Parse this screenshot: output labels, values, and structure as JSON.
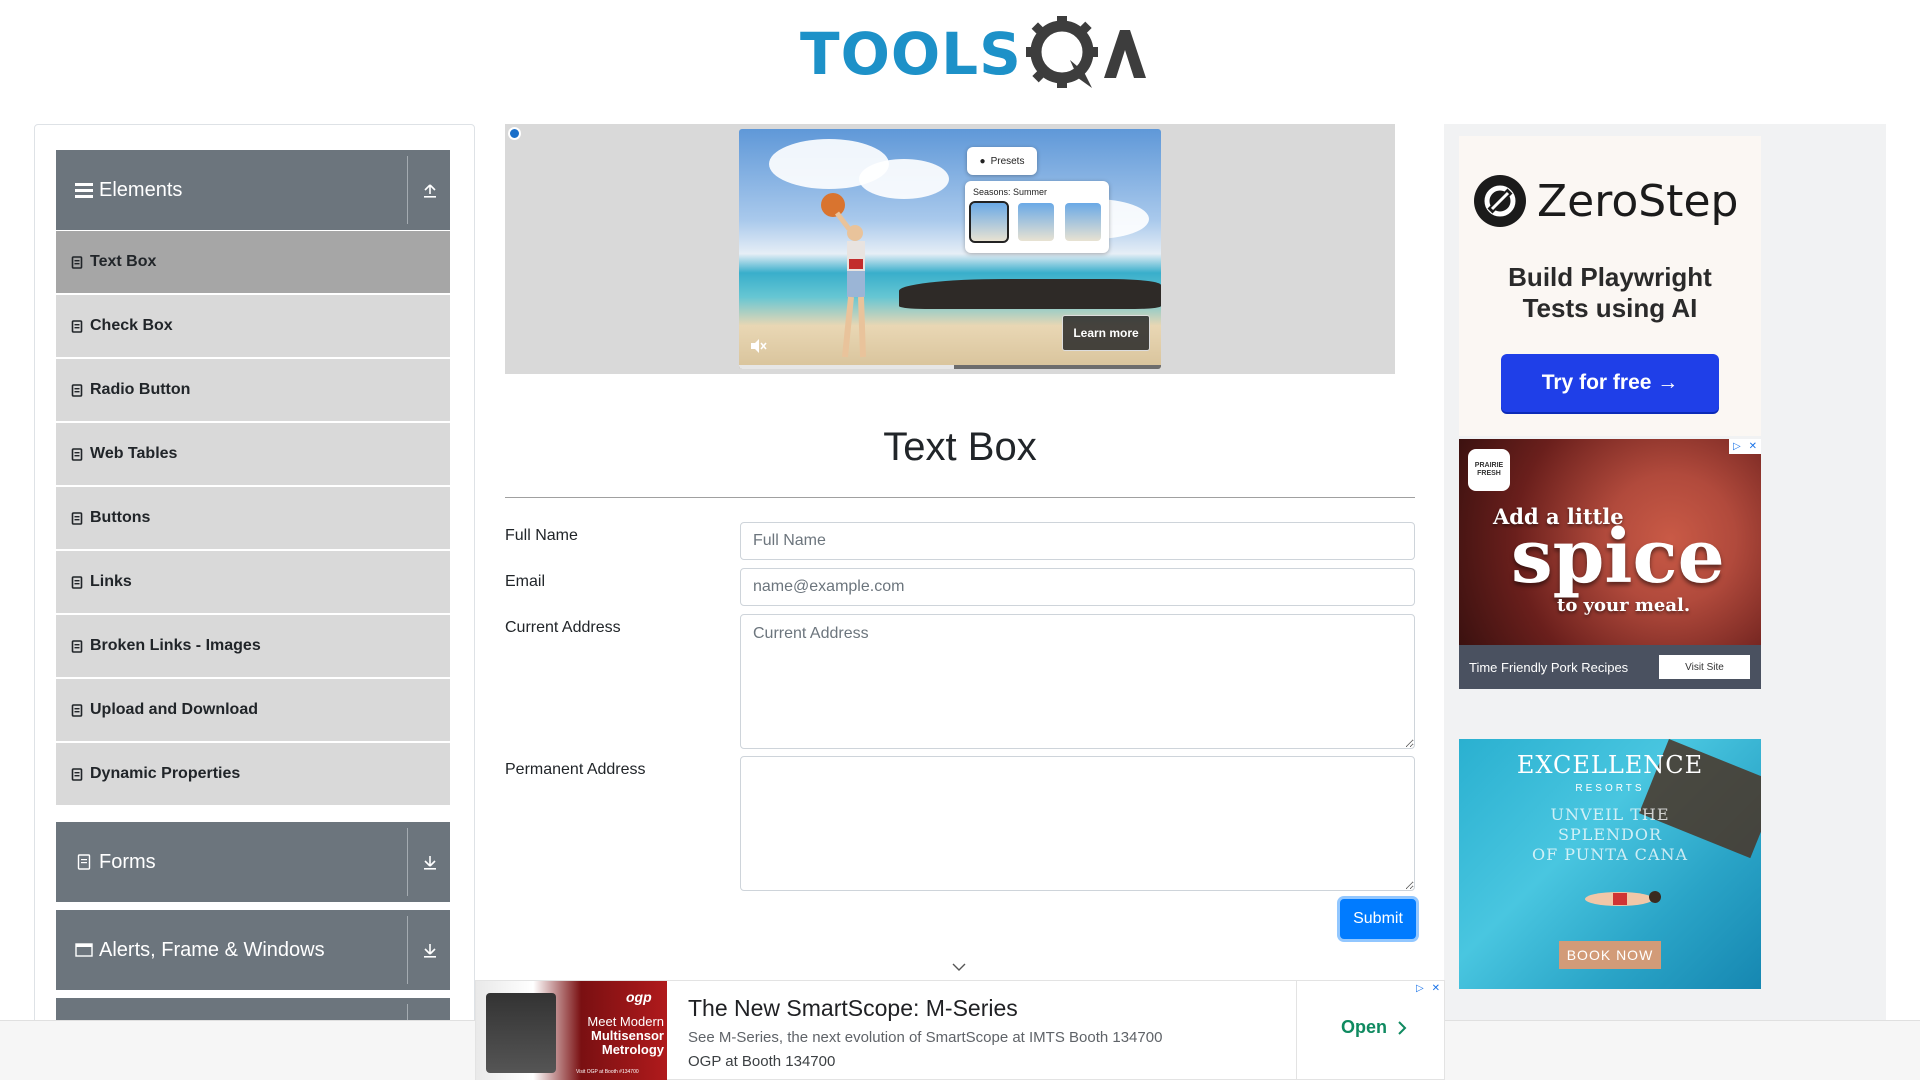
{
  "header": {
    "logo_text": "TOOLSQA"
  },
  "sidebar": {
    "groups": [
      {
        "title": "Elements",
        "icon": "hamburger-icon",
        "expanded": true,
        "arrow": "collapse-arrow-icon"
      },
      {
        "title": "Forms",
        "icon": "file-icon",
        "expanded": false,
        "arrow": "expand-arrow-icon"
      },
      {
        "title": "Alerts, Frame & Windows",
        "icon": "window-icon",
        "expanded": false,
        "arrow": "expand-arrow-icon"
      }
    ],
    "items": [
      {
        "label": "Text Box",
        "active": true
      },
      {
        "label": "Check Box",
        "active": false
      },
      {
        "label": "Radio Button",
        "active": false
      },
      {
        "label": "Web Tables",
        "active": false
      },
      {
        "label": "Buttons",
        "active": false
      },
      {
        "label": "Links",
        "active": false
      },
      {
        "label": "Broken Links - Images",
        "active": false
      },
      {
        "label": "Upload and Download",
        "active": false
      },
      {
        "label": "Dynamic Properties",
        "active": false
      }
    ]
  },
  "video_ad": {
    "presets_label": "Presets",
    "seasons_label": "Seasons: Summer",
    "learn_more": "Learn more",
    "progress": 0.51
  },
  "main": {
    "title": "Text Box",
    "fields": [
      {
        "label": "Full Name",
        "placeholder": "Full Name",
        "value": ""
      },
      {
        "label": "Email",
        "placeholder": "name@example.com",
        "value": ""
      },
      {
        "label": "Current Address",
        "placeholder": "Current Address",
        "value": ""
      },
      {
        "label": "Permanent Address",
        "placeholder": "",
        "value": ""
      }
    ],
    "submit_label": "Submit"
  },
  "right_ads": {
    "zerostep": {
      "brand": "ZeroStep",
      "tagline_1": "Build Playwright",
      "tagline_2": "Tests using AI",
      "cta": "Try for free →",
      "accent": "#1f3fe8"
    },
    "pork": {
      "badge": "PRAIRIE FRESH",
      "line_1": "Add a little",
      "line_2": "spice",
      "line_3": "to your meal.",
      "caption": "Time Friendly Pork Recipes",
      "cta": "Visit Site"
    },
    "excellence": {
      "brand": "EXCELLENCE",
      "sub": "RESORTS",
      "tagline_1": "UNVEIL THE SPLENDOR",
      "tagline_2": "OF PUNTA CANA",
      "cta": "BOOK NOW"
    }
  },
  "bottom_ad": {
    "image_brand": "ogp",
    "image_line_1": "Meet Modern",
    "image_line_2": "Multisensor",
    "image_line_3": "Metrology",
    "image_sub": "Visit OGP at Booth #134700",
    "title": "The New SmartScope: M-Series",
    "description": "See M-Series, the next evolution of SmartScope at IMTS Booth 134700",
    "advertiser": "OGP at Booth 134700",
    "cta": "Open"
  }
}
